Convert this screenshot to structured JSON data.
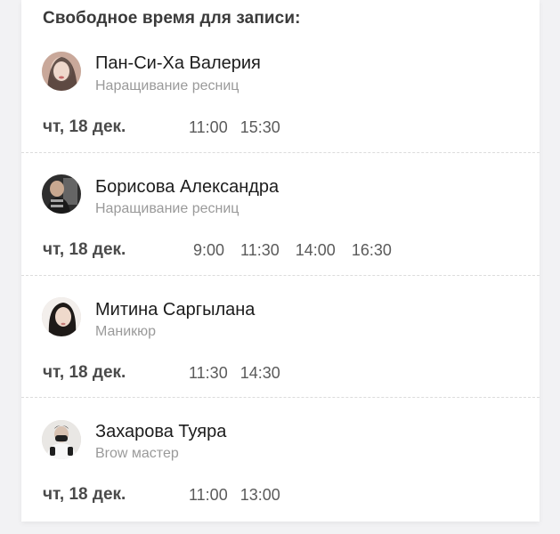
{
  "header": {
    "title": "Свободное время для записи:"
  },
  "masters": [
    {
      "name": "Пан-Си-Ха Валерия",
      "service": "Наращивание ресниц",
      "date": "чт, 18 дек.",
      "slots": [
        "11:00",
        "15:30"
      ],
      "avatar": "photo-avatar-1"
    },
    {
      "name": "Борисова Александра",
      "service": "Наращивание ресниц",
      "date": "чт, 18 дек.",
      "slots": [
        "9:00",
        "11:30",
        "14:00",
        "16:30"
      ],
      "avatar": "photo-avatar-2"
    },
    {
      "name": "Митина Саргылана",
      "service": "Маникюр",
      "date": "чт, 18 дек.",
      "slots": [
        "11:30",
        "14:30"
      ],
      "avatar": "photo-avatar-3"
    },
    {
      "name": "Захарова Туяра",
      "service": "Brow мастер",
      "date": "чт, 18 дек.",
      "slots": [
        "11:00",
        "13:00"
      ],
      "avatar": "photo-avatar-4"
    }
  ]
}
